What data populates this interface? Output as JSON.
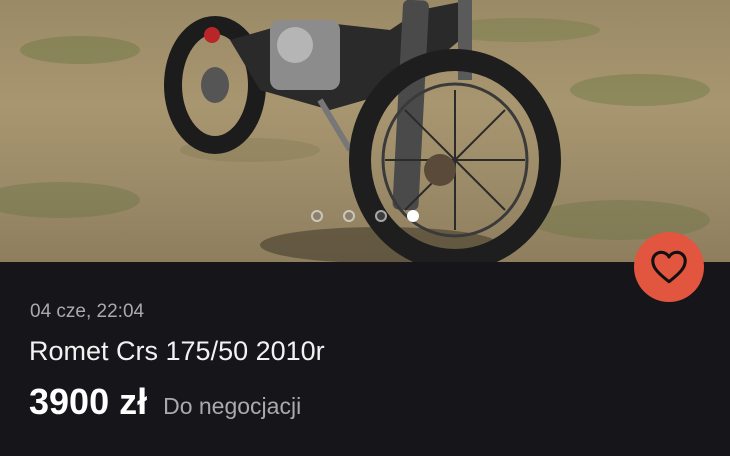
{
  "listing": {
    "date": "04 cze, 22:04",
    "title": "Romet Crs 175/50 2010r",
    "price": "3900 zł",
    "negotiable": "Do negocjacji"
  },
  "gallery": {
    "image_count": 4,
    "active_index": 4
  },
  "favorite": {
    "icon": "heart-icon",
    "color": "#e2553f"
  },
  "colors": {
    "background": "#16161a",
    "accent": "#e2553f"
  }
}
